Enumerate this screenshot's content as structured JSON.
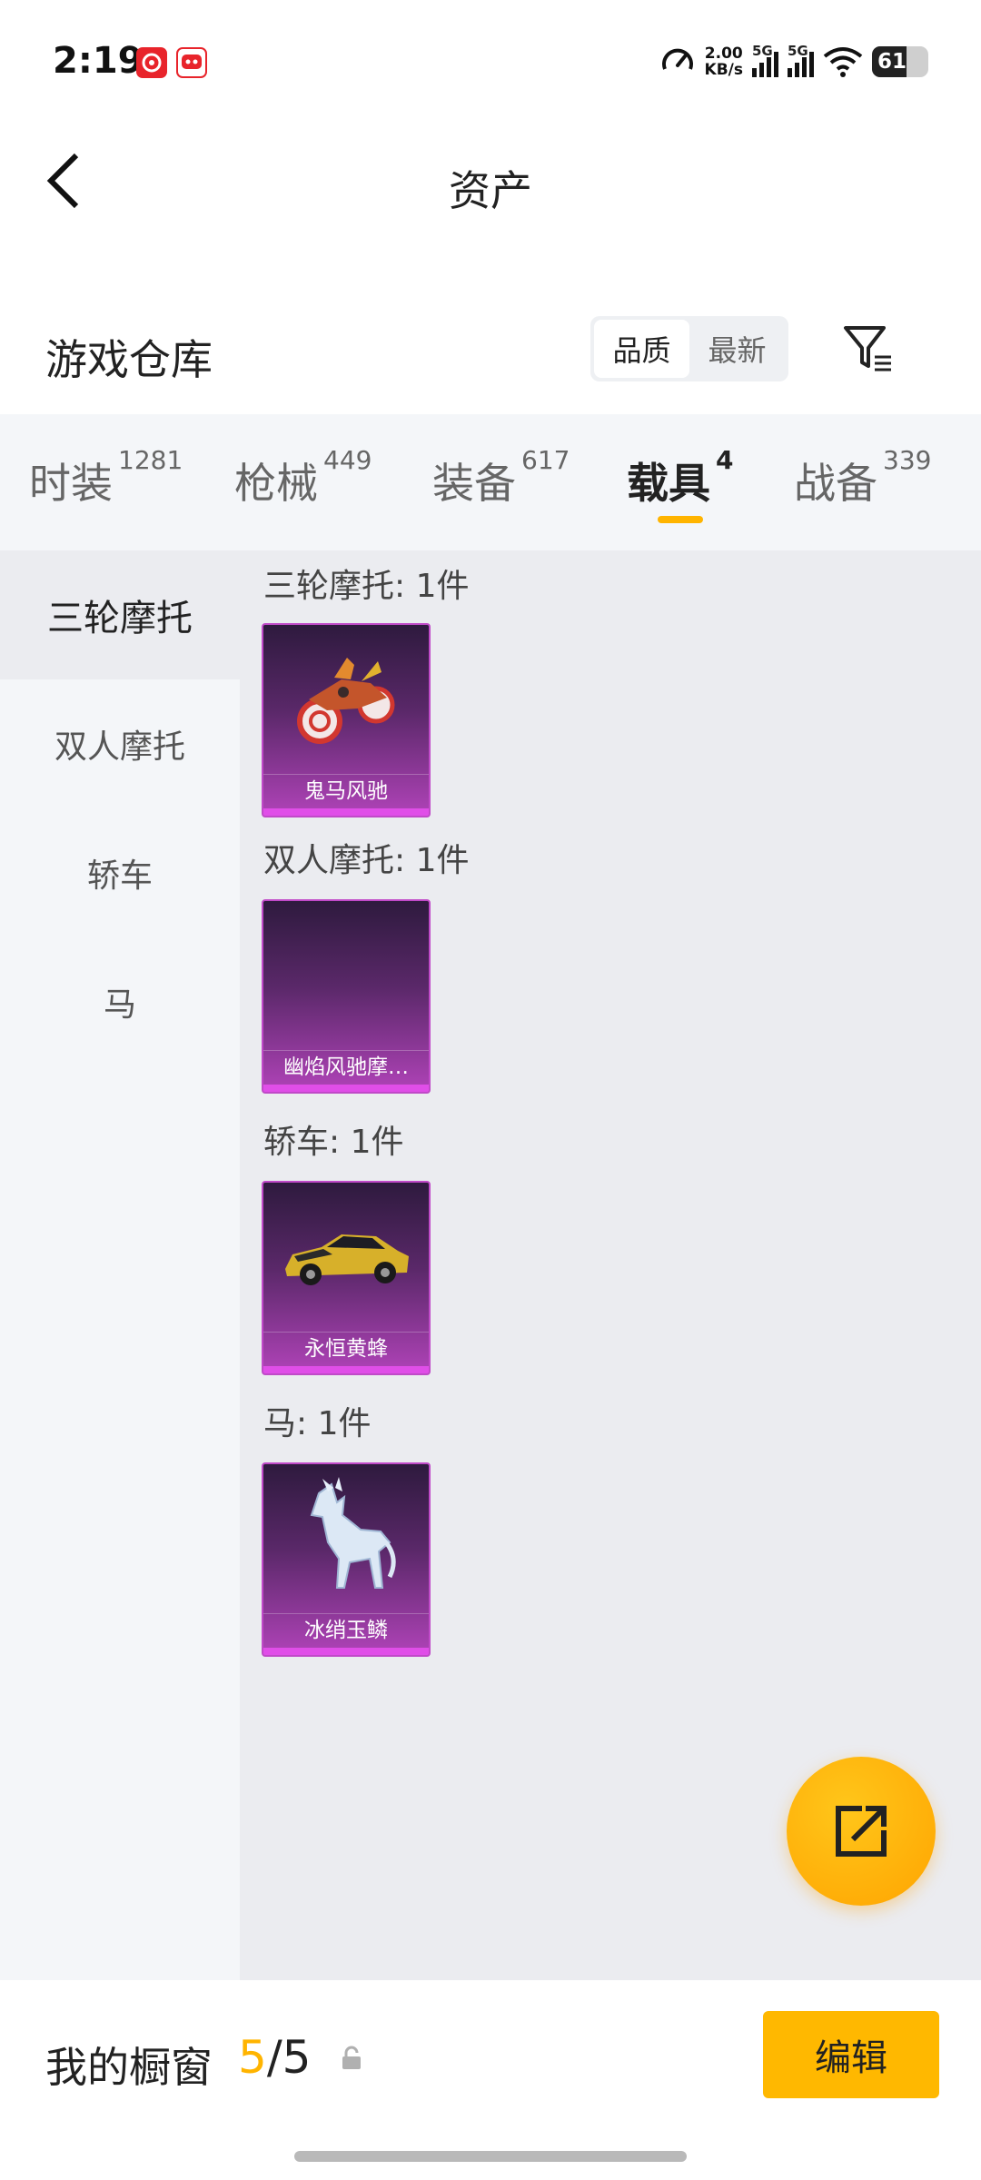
{
  "status_bar": {
    "time": "2:19",
    "net_speed_value": "2.00",
    "net_speed_unit": "KB/s",
    "signal1_label": "5G",
    "signal2_label": "5G",
    "battery_level": 61
  },
  "header": {
    "title": "资产"
  },
  "section": {
    "title": "游戏仓库",
    "sort_options": [
      "品质",
      "最新"
    ],
    "sort_selected": "品质"
  },
  "tabs": [
    {
      "label": "时装",
      "count": "1281"
    },
    {
      "label": "枪械",
      "count": "449"
    },
    {
      "label": "装备",
      "count": "617"
    },
    {
      "label": "载具",
      "count": "4"
    },
    {
      "label": "战备",
      "count": "339"
    }
  ],
  "active_tab": "载具",
  "sidebar": {
    "items": [
      "三轮摩托",
      "双人摩托",
      "轿车",
      "马"
    ],
    "active": "三轮摩托"
  },
  "groups": [
    {
      "label": "三轮摩托: 1件",
      "item_name": "鬼马风驰",
      "art": "tricycle-motorcycle-icon"
    },
    {
      "label": "双人摩托: 1件",
      "item_name": "幽焰风驰摩…",
      "art": ""
    },
    {
      "label": "轿车: 1件",
      "item_name": "永恒黄蜂",
      "art": "sports-car-icon"
    },
    {
      "label": "马: 1件",
      "item_name": "冰绡玉鳞",
      "art": "ice-horse-icon"
    }
  ],
  "bottom": {
    "showcase_label": "我的橱窗",
    "showcase_current": "5",
    "showcase_separator": "/",
    "showcase_total": "5",
    "edit_label": "编辑"
  },
  "colors": {
    "accent": "#ffb400",
    "card_rarity_purple": "#c04ac8"
  }
}
